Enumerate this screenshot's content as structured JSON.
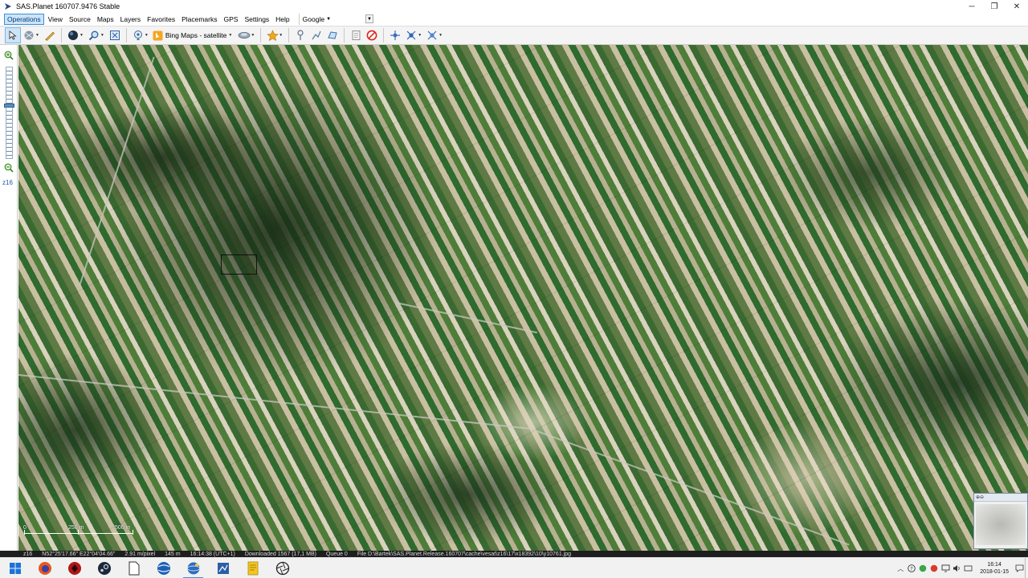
{
  "window": {
    "title": "SAS.Planet 160707.9476 Stable",
    "controls": {
      "minimize": "─",
      "maximize": "❐",
      "close": "✕"
    }
  },
  "menu": {
    "items": [
      "Operations",
      "View",
      "Source",
      "Maps",
      "Layers",
      "Favorites",
      "Placemarks",
      "GPS",
      "Settings",
      "Help"
    ],
    "active": "Operations",
    "search_provider": "Google"
  },
  "toolbar": {
    "map_source": "Bing Maps - satellite"
  },
  "zoombar": {
    "zoom_level": "z16",
    "zoom_fraction": 0.42
  },
  "map": {
    "scale": {
      "labels": [
        "0",
        "250 m",
        "500 m"
      ]
    }
  },
  "statusbar": {
    "zoom": "z16",
    "coordinates": "N52°25'17.66\" E22°04'04.66\"",
    "resolution": "2.91 m/pixel",
    "distance": "145 m",
    "time": "16:14:38 (UTC+1)",
    "downloaded": "Downloaded 1567 (17,1 MB)",
    "queue": "Queue 0",
    "file": "File D:\\Bartek\\SAS.Planet.Release.160707\\cache\\vesat\\z16\\17\\x18392\\10\\y10761.jpg"
  },
  "taskbar": {
    "clock_time": "16:14",
    "clock_date": "2018-01-15"
  },
  "colors": {
    "accent": "#3b8fd9",
    "close_red": "#d9261c",
    "star_yellow": "#f2a81d"
  }
}
